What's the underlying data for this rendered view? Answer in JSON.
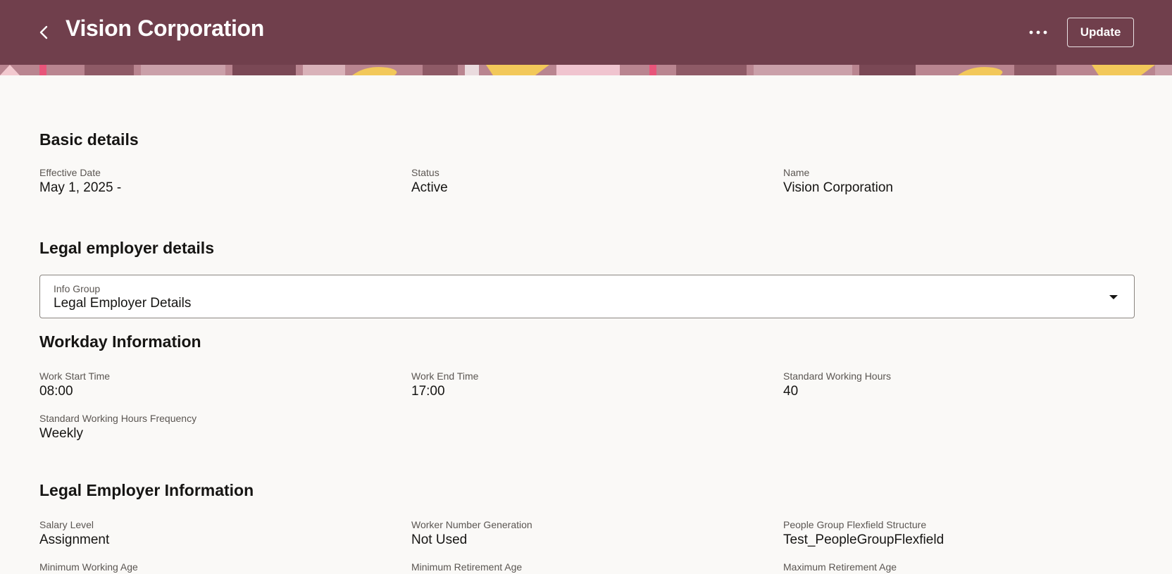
{
  "header": {
    "title": "Vision Corporation",
    "update_label": "Update",
    "colors": {
      "background": "#703f4c",
      "text": "#ffffff"
    },
    "icons": {
      "back": "chevron-left-icon",
      "more": "more-horizontal-icon"
    }
  },
  "basic_details": {
    "title": "Basic details",
    "fields": [
      {
        "label": "Effective Date",
        "value": "May 1, 2025 -"
      },
      {
        "label": "Status",
        "value": "Active"
      },
      {
        "label": "Name",
        "value": "Vision Corporation"
      }
    ]
  },
  "legal_employer_details": {
    "title": "Legal employer details",
    "info_group": {
      "label": "Info Group",
      "value": "Legal Employer Details",
      "icon": "caret-down-icon"
    }
  },
  "workday_information": {
    "title": "Workday Information",
    "fields": [
      {
        "label": "Work Start Time",
        "value": "08:00"
      },
      {
        "label": "Work End Time",
        "value": "17:00"
      },
      {
        "label": "Standard Working Hours",
        "value": "40"
      },
      {
        "label": "Standard Working Hours Frequency",
        "value": "Weekly"
      }
    ]
  },
  "legal_employer_information": {
    "title": "Legal Employer Information",
    "fields": [
      {
        "label": "Salary Level",
        "value": "Assignment"
      },
      {
        "label": "Worker Number Generation",
        "value": "Not Used"
      },
      {
        "label": "People Group Flexfield Structure",
        "value": "Test_PeopleGroupFlexfield"
      },
      {
        "label": "Minimum Working Age",
        "value": ""
      },
      {
        "label": "Minimum Retirement Age",
        "value": ""
      },
      {
        "label": "Maximum Retirement Age",
        "value": ""
      }
    ]
  }
}
